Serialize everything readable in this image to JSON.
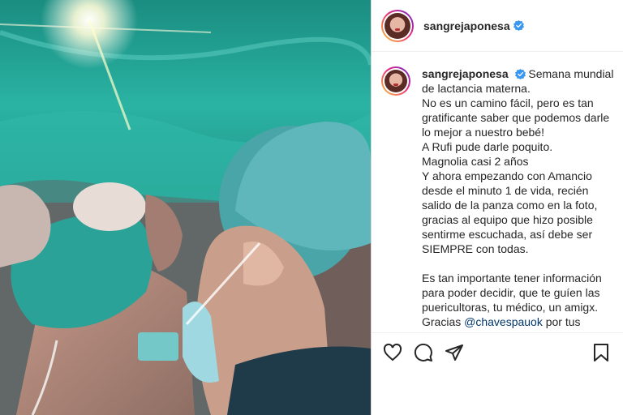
{
  "post": {
    "username": "sangrejaponesa",
    "verified": true,
    "caption_lines": [
      "Semana mundial de lactancia materna.",
      "No es un camino fácil, pero es tan gratificante saber que podemos darle lo mejor a nuestro bebé!",
      "A Rufi pude darle poquito.",
      "Magnolia casi 2 años",
      "Y ahora empezando con Amancio desde el minuto 1 de vida, recién salido de la panza como en la foto, gracias al equipo que hizo posible sentirme escuchada, así debe ser SIEMPRE con todas.",
      "Es tan importante tener información para poder decidir, que te guíen las puericultoras, tu médico, un amigx.",
      "Gracias",
      "@chavespauok",
      "por tus consejos y tu aguante siempre",
      "♥"
    ]
  },
  "actions": {
    "like": "heart-icon",
    "comment": "comment-icon",
    "share": "share-icon",
    "save": "bookmark-icon"
  },
  "colors": {
    "verified_blue": "#3897f0",
    "mention": "#00376b",
    "drape_teal": "#2aa79a"
  }
}
